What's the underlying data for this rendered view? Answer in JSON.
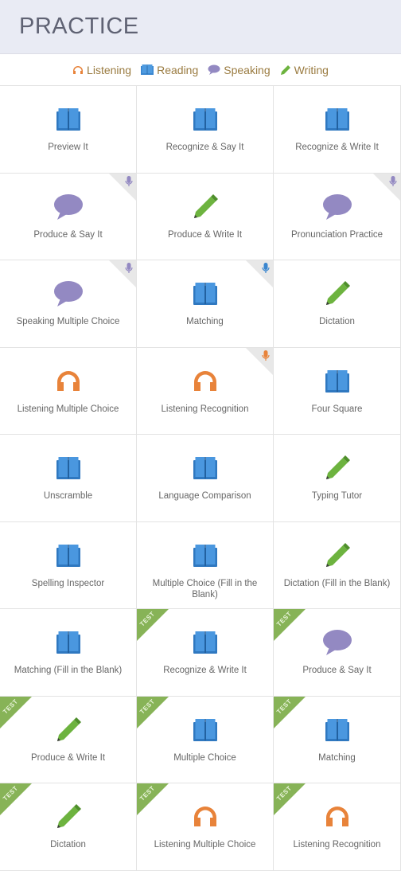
{
  "header": {
    "title": "PRACTICE"
  },
  "legend": [
    {
      "label": "Listening",
      "icon": "headphones-icon",
      "color": "#e8833a"
    },
    {
      "label": "Reading",
      "icon": "book-icon",
      "color": "#3a86cf"
    },
    {
      "label": "Speaking",
      "icon": "speech-bubble-icon",
      "color": "#9389c2"
    },
    {
      "label": "Writing",
      "icon": "pencil-icon",
      "color": "#6db33f"
    }
  ],
  "tiles": [
    {
      "label": "Preview It",
      "icon": "book"
    },
    {
      "label": "Recognize & Say It",
      "icon": "book"
    },
    {
      "label": "Recognize & Write It",
      "icon": "book"
    },
    {
      "label": "Produce & Say It",
      "icon": "bubble",
      "corner": "speaking"
    },
    {
      "label": "Produce & Write It",
      "icon": "pencil"
    },
    {
      "label": "Pronunciation Practice",
      "icon": "bubble",
      "corner": "speaking"
    },
    {
      "label": "Speaking Multiple Choice",
      "icon": "bubble",
      "corner": "speaking"
    },
    {
      "label": "Matching",
      "icon": "book",
      "corner": "reading"
    },
    {
      "label": "Dictation",
      "icon": "pencil"
    },
    {
      "label": "Listening Multiple Choice",
      "icon": "headphones"
    },
    {
      "label": "Listening Recognition",
      "icon": "headphones",
      "corner": "listening"
    },
    {
      "label": "Four Square",
      "icon": "book"
    },
    {
      "label": "Unscramble",
      "icon": "book"
    },
    {
      "label": "Language Comparison",
      "icon": "book"
    },
    {
      "label": "Typing Tutor",
      "icon": "pencil"
    },
    {
      "label": "Spelling Inspector",
      "icon": "book"
    },
    {
      "label": "Multiple Choice (Fill in the Blank)",
      "icon": "book"
    },
    {
      "label": "Dictation (Fill in the Blank)",
      "icon": "pencil"
    },
    {
      "label": "Matching (Fill in the Blank)",
      "icon": "book"
    },
    {
      "label": "Recognize & Write It",
      "icon": "book",
      "ribbon": "TEST"
    },
    {
      "label": "Produce & Say It",
      "icon": "bubble",
      "ribbon": "TEST"
    },
    {
      "label": "Produce & Write It",
      "icon": "pencil",
      "ribbon": "TEST"
    },
    {
      "label": "Multiple Choice",
      "icon": "book",
      "ribbon": "TEST"
    },
    {
      "label": "Matching",
      "icon": "book",
      "ribbon": "TEST"
    },
    {
      "label": "Dictation",
      "icon": "pencil",
      "ribbon": "TEST"
    },
    {
      "label": "Listening Multiple Choice",
      "icon": "headphones",
      "ribbon": "TEST"
    },
    {
      "label": "Listening Recognition",
      "icon": "headphones",
      "ribbon": "TEST"
    }
  ]
}
